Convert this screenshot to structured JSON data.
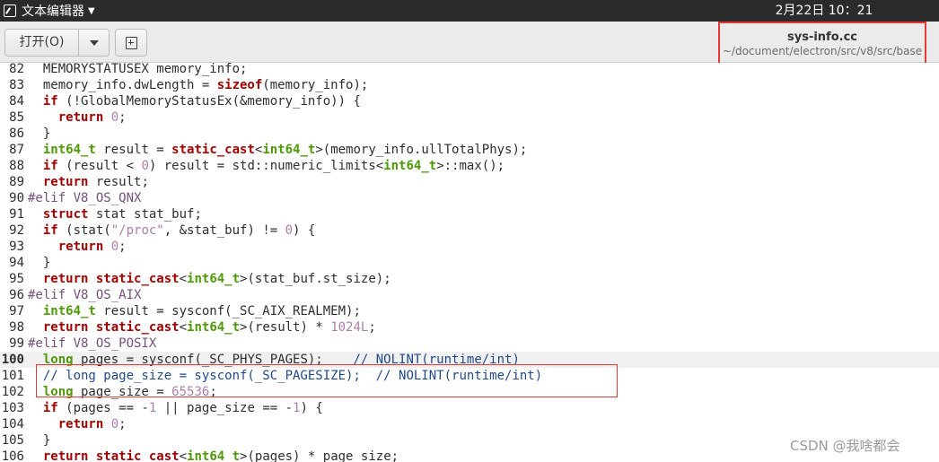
{
  "topbar": {
    "app_name": "文本编辑器",
    "clock": "2月22日  10：21"
  },
  "header": {
    "open_label": "打开(O)",
    "file_title": "sys-info.cc",
    "file_path": "~/document/electron/src/v8/src/base"
  },
  "editor": {
    "current_line": 100,
    "lines": [
      {
        "n": "82",
        "code": "  MEMORYSTATUSEX memory_info;"
      },
      {
        "n": "83",
        "code": "  memory_info.dwLength = sizeof(memory_info);"
      },
      {
        "n": "84",
        "code": "  if (!GlobalMemoryStatusEx(&memory_info)) {"
      },
      {
        "n": "85",
        "code": "    return 0;"
      },
      {
        "n": "86",
        "code": "  }"
      },
      {
        "n": "87",
        "code": "  int64_t result = static_cast<int64_t>(memory_info.ullTotalPhys);"
      },
      {
        "n": "88",
        "code": "  if (result < 0) result = std::numeric_limits<int64_t>::max();"
      },
      {
        "n": "89",
        "code": "  return result;"
      },
      {
        "n": "90",
        "code": "#elif V8_OS_QNX"
      },
      {
        "n": "91",
        "code": "  struct stat stat_buf;"
      },
      {
        "n": "92",
        "code": "  if (stat(\"/proc\", &stat_buf) != 0) {"
      },
      {
        "n": "93",
        "code": "    return 0;"
      },
      {
        "n": "94",
        "code": "  }"
      },
      {
        "n": "95",
        "code": "  return static_cast<int64_t>(stat_buf.st_size);"
      },
      {
        "n": "96",
        "code": "#elif V8_OS_AIX"
      },
      {
        "n": "97",
        "code": "  int64_t result = sysconf(_SC_AIX_REALMEM);"
      },
      {
        "n": "98",
        "code": "  return static_cast<int64_t>(result) * 1024L;"
      },
      {
        "n": "99",
        "code": "#elif V8_OS_POSIX"
      },
      {
        "n": "100",
        "code": "  long pages = sysconf(_SC_PHYS_PAGES);    // NOLINT(runtime/int)"
      },
      {
        "n": "101",
        "code": "  // long page_size = sysconf(_SC_PAGESIZE);  // NOLINT(runtime/int)"
      },
      {
        "n": "102",
        "code": "  long page_size = 65536;"
      },
      {
        "n": "103",
        "code": "  if (pages == -1 || page_size == -1) {"
      },
      {
        "n": "104",
        "code": "    return 0;"
      },
      {
        "n": "105",
        "code": "  }"
      },
      {
        "n": "106",
        "code": "  return static_cast<int64_t>(pages) * page_size;"
      }
    ]
  },
  "watermark": "CSDN @我啥都会",
  "colors": {
    "keyword": "#a40000",
    "type": "#4e9a06",
    "number": "#ad7fa8",
    "preprocessor": "#75507b",
    "comment": "#204a87",
    "highlight_box": "#e53935"
  }
}
